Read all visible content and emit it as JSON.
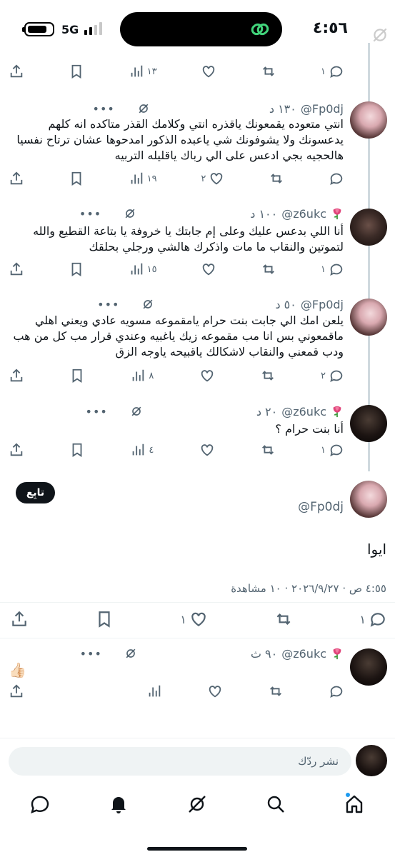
{
  "status_bar": {
    "time": "٤:٥٦",
    "network": "5G"
  },
  "tweets": [
    {
      "actions": {
        "reply": "١",
        "repost": "",
        "like": "",
        "views": "١٣",
        "bookmark": "",
        "share": ""
      }
    },
    {
      "handle": "@Fp0dj",
      "time": "١٣٠ د",
      "text": "انتي متعوده يقمعونك ياقذره انتي وكلامك القذر متاكده انه كلهم يدعسونك ولا يشوفونك شي ياعبده الذكور امدحوها عشان ترتاح نفسيا هالحجيه بجي ادعس على الي رباك ياقليله التربيه",
      "actions": {
        "reply": "",
        "repost": "",
        "like": "٢",
        "views": "١٩"
      }
    },
    {
      "handle": "@z6ukc",
      "time": "١٠٠ د",
      "text": "أنا اللي بدعس عليك وعلى إم جابتك يا خروفة يا بتاعة القطيع والله لتموتين والنقاب ما مات واذكرك هالشي ورجلي بحلقك",
      "actions": {
        "reply": "١",
        "repost": "",
        "like": "",
        "views": "١٥"
      }
    },
    {
      "handle": "@Fp0dj",
      "time": "٥٠ د",
      "text": "يلعن امك الي جابت بنت حرام يامقموعه مسويه عادي ويعني اهلي ماقمعوني بس انا مب مقموعه زيك ياغبيه وعندي قرار مب كل من هب ودب قمعني والنقاب لاشكالك ياقبيحه ياوجه الزق",
      "actions": {
        "reply": "٢",
        "repost": "",
        "like": "",
        "views": "٨"
      }
    },
    {
      "handle": "@z6ukc",
      "time": "٢٠ د",
      "text": "أنا بنت حرام ؟",
      "actions": {
        "reply": "١",
        "repost": "",
        "like": "",
        "views": "٤"
      }
    }
  ],
  "main_tweet": {
    "handle": "@Fp0dj",
    "follow_label": "تابِع",
    "text": "ايوا",
    "meta": "٤:٥٥ ص · ٢٠٢٦/٩/٢٧ · ١٠ مشاهدة",
    "actions": {
      "reply": "١",
      "repost": "",
      "like": "١",
      "bookmark": "",
      "share": ""
    }
  },
  "reply_tweet": {
    "handle": "@z6ukc",
    "time": "٩٠ ث",
    "emoji": "👍🏻"
  },
  "composer": {
    "placeholder": "نشر ردّك"
  },
  "icons": {
    "reply": "comment-icon",
    "repost": "repost-icon",
    "like": "heart-icon",
    "views": "views-icon",
    "bookmark": "bookmark-icon",
    "share": "share-icon",
    "grok": "grok-icon",
    "more": "more-icon",
    "rose": "rose-emoji"
  },
  "tabs": [
    "home-icon",
    "search-icon",
    "grok-icon",
    "notifications-icon",
    "messages-icon"
  ],
  "colors": {
    "text": "#0f1419",
    "muted": "#536471",
    "accent": "#1d9bf0",
    "divider": "#eff3f4"
  }
}
